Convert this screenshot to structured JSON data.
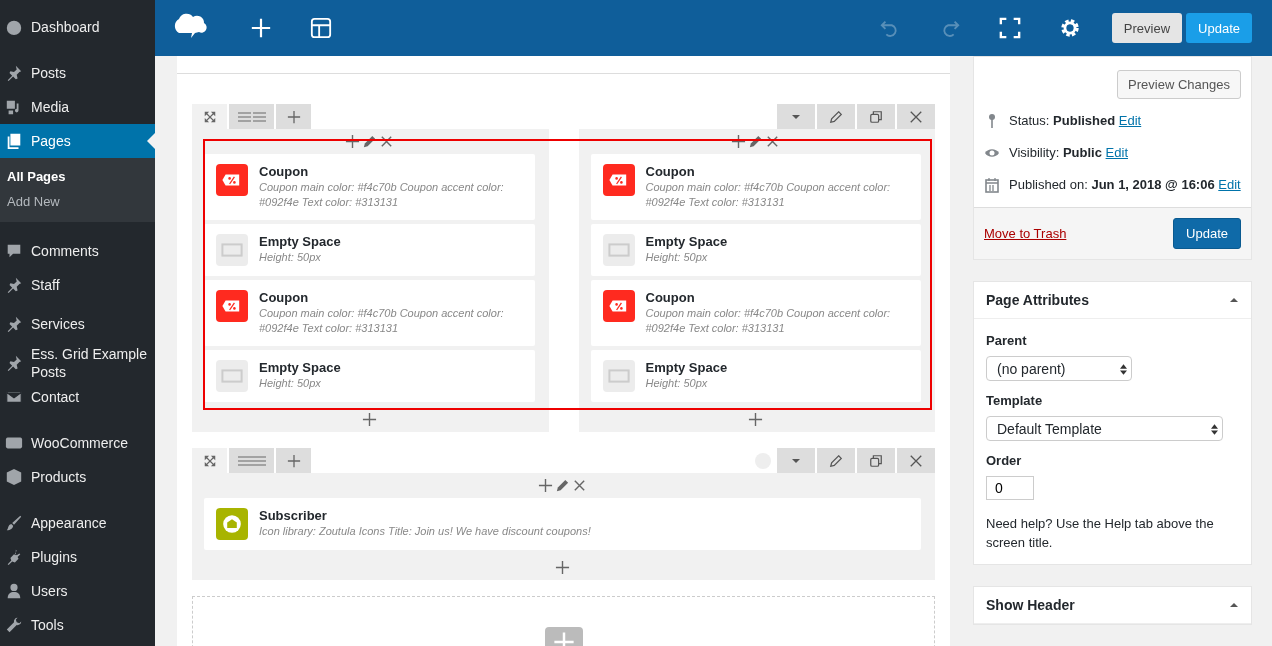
{
  "sidebar": {
    "items": [
      {
        "label": "Dashboard",
        "selected": false
      },
      {
        "label": "Posts",
        "selected": false
      },
      {
        "label": "Media",
        "selected": false
      },
      {
        "label": "Pages",
        "selected": true,
        "children": [
          {
            "label": "All Pages",
            "selected": true
          },
          {
            "label": "Add New",
            "selected": false
          }
        ]
      },
      {
        "label": "Comments",
        "selected": false
      },
      {
        "label": "Staff",
        "selected": false
      },
      {
        "label": "Services",
        "selected": false
      },
      {
        "label": "Ess. Grid Example Posts",
        "selected": false
      },
      {
        "label": "Contact",
        "selected": false
      },
      {
        "label": "WooCommerce",
        "selected": false
      },
      {
        "label": "Products",
        "selected": false
      },
      {
        "label": "Appearance",
        "selected": false
      },
      {
        "label": "Plugins",
        "selected": false
      },
      {
        "label": "Users",
        "selected": false
      },
      {
        "label": "Tools",
        "selected": false
      }
    ]
  },
  "topbar": {
    "undo": {
      "disabled": true
    },
    "redo": {
      "disabled": true
    },
    "preview": "Preview",
    "update": "Update"
  },
  "rows": [
    {
      "columns": [
        {
          "elements": [
            {
              "kind": "coupon",
              "title": "Coupon",
              "description": "Coupon main color: #f4c70b  Coupon accent color: #092f4e  Text color: #313131"
            },
            {
              "kind": "empty_space",
              "title": "Empty Space",
              "description": "Height: 50px"
            },
            {
              "kind": "coupon",
              "title": "Coupon",
              "description": "Coupon main color: #f4c70b  Coupon accent color: #092f4e  Text color: #313131"
            },
            {
              "kind": "empty_space",
              "title": "Empty Space",
              "description": "Height: 50px"
            }
          ]
        },
        {
          "elements": [
            {
              "kind": "coupon",
              "title": "Coupon",
              "description": "Coupon main color: #f4c70b  Coupon accent color: #092f4e  Text color: #313131"
            },
            {
              "kind": "empty_space",
              "title": "Empty Space",
              "description": "Height: 50px"
            },
            {
              "kind": "coupon",
              "title": "Coupon",
              "description": "Coupon main color: #f4c70b  Coupon accent color: #092f4e  Text color: #313131"
            },
            {
              "kind": "empty_space",
              "title": "Empty Space",
              "description": "Height: 50px"
            }
          ]
        }
      ]
    },
    {
      "columns": [
        {
          "elements": [
            {
              "kind": "subscriber",
              "title": "Subscriber",
              "description": "Icon library: Zoutula Icons  Title: Join us! We have discount coupons!"
            }
          ]
        }
      ]
    }
  ],
  "publish": {
    "preview_changes": "Preview Changes",
    "lines": [
      {
        "text": "Status: **Published**",
        "link": "Edit"
      },
      {
        "text": "Visibility: **Public**",
        "link": "Edit"
      },
      {
        "text": "Published on: **Jun 1, 2018 @ 16:06**",
        "link": "Edit"
      }
    ],
    "trash": "Move to Trash",
    "update": "Update"
  },
  "page_attributes": {
    "title": "Page Attributes",
    "parent_label": "Parent",
    "parent": "(no parent)",
    "template_label": "Template",
    "template": "Default Template",
    "order_label": "Order",
    "order": "0",
    "help": "Need help? Use the Help tab above the screen title."
  },
  "show_header": {
    "title": "Show Header"
  }
}
